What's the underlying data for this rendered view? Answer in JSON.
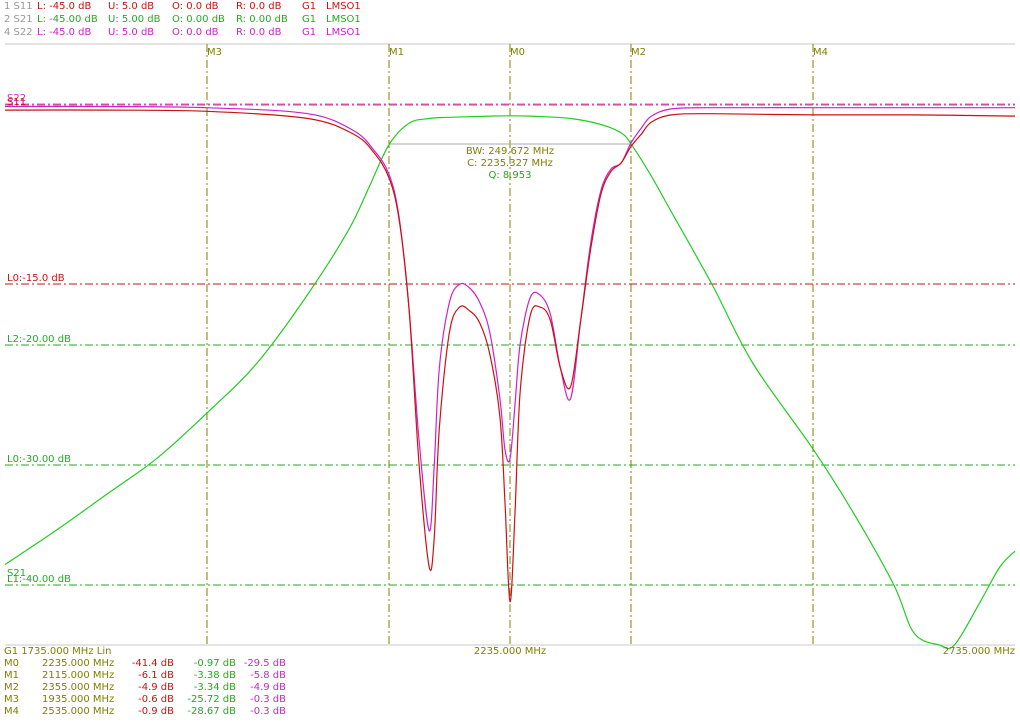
{
  "colors": {
    "s11": "#cc1111",
    "s21": "#22cc22",
    "s22": "#cc22cc",
    "grid": "#808000",
    "hdr_index": "#999999"
  },
  "header": [
    {
      "index": "1 S11",
      "L": "L: -45.0 dB",
      "U": "U:  5.0 dB",
      "O": "O:  0.0 dB",
      "R": "R:  0.0 dB",
      "G": "G1",
      "mode": "LMSO1",
      "color": "#cc1111"
    },
    {
      "index": "2 S21",
      "L": "L: -45.00 dB",
      "U": "U: 5.00 dB",
      "O": "O:  0.00 dB",
      "R": "R:  0.00 dB",
      "G": "G1",
      "mode": "LMSO1",
      "color": "#22aa22"
    },
    {
      "index": "4 S22",
      "L": "L: -45.0 dB",
      "U": "U:  5.0 dB",
      "O": "O:  0.0 dB",
      "R": "R:  0.0 dB",
      "G": "G1",
      "mode": "LMSO1",
      "color": "#cc22cc"
    }
  ],
  "markers_top": [
    "M3",
    "M1",
    "M0",
    "M2",
    "M4"
  ],
  "trace_labels": {
    "s22": "S22",
    "s11": "S11",
    "s21": "S21"
  },
  "limit_lines": [
    {
      "label": "L0:-15.0 dB",
      "color": "#cc1111"
    },
    {
      "label": "L2:-20.00 dB",
      "color": "#22aa22"
    },
    {
      "label": "L0:-30.00 dB",
      "color": "#22aa22"
    },
    {
      "label": "L1:-40.00 dB",
      "color": "#22aa22"
    }
  ],
  "bw_box": {
    "bw": "BW: 249.672 MHz",
    "c": "C: 2235.327 MHz",
    "q": "Q: 8.953"
  },
  "axis": {
    "left": "G1    1735.000 MHz  Lin",
    "center": "2235.000 MHz",
    "right": "2735.000 MHz"
  },
  "marker_table": [
    {
      "name": "M0",
      "freq": "2235.000 MHz",
      "s11": "-41.4 dB",
      "s21": "-0.97 dB",
      "s22": "-29.5 dB"
    },
    {
      "name": "M1",
      "freq": "2115.000 MHz",
      "s11": "-6.1 dB",
      "s21": "-3.38 dB",
      "s22": "-5.8 dB"
    },
    {
      "name": "M2",
      "freq": "2355.000 MHz",
      "s11": "-4.9 dB",
      "s21": "-3.34 dB",
      "s22": "-4.9 dB"
    },
    {
      "name": "M3",
      "freq": "1935.000 MHz",
      "s11": "-0.6 dB",
      "s21": "-25.72 dB",
      "s22": "-0.3 dB"
    },
    {
      "name": "M4",
      "freq": "2535.000 MHz",
      "s11": "-0.9 dB",
      "s21": "-28.67 dB",
      "s22": "-0.3 dB"
    }
  ],
  "chart_data": {
    "type": "line",
    "x_range_mhz": [
      1735,
      2735
    ],
    "y_range_db": [
      -45,
      5
    ],
    "markers_mhz": {
      "M3": 1935,
      "M1": 2115,
      "M0": 2235,
      "M2": 2355,
      "M4": 2535
    },
    "limit_lines_db": [
      -15,
      -20,
      -30,
      -40
    ],
    "series": [
      {
        "name": "S11",
        "color": "#cc1111",
        "x": [
          1735,
          1835,
          1935,
          2035,
          2080,
          2100,
          2115,
          2125,
          2135,
          2145,
          2155,
          2160,
          2165,
          2175,
          2185,
          2195,
          2205,
          2215,
          2225,
          2230,
          2235,
          2240,
          2245,
          2255,
          2265,
          2275,
          2285,
          2295,
          2305,
          2315,
          2325,
          2335,
          2345,
          2355,
          2365,
          2375,
          2395,
          2435,
          2535,
          2635,
          2735
        ],
        "y": [
          -0.5,
          -0.5,
          -0.6,
          -1.2,
          -2.5,
          -4.0,
          -6.1,
          -9.5,
          -17,
          -30,
          -38.5,
          -36,
          -27,
          -19,
          -16.9,
          -17.2,
          -18.2,
          -20.8,
          -26,
          -33,
          -41.4,
          -34,
          -24,
          -17.6,
          -16.9,
          -18,
          -22,
          -23.5,
          -18,
          -12,
          -7.5,
          -5.6,
          -4.9,
          -3.5,
          -2.5,
          -1.5,
          -0.9,
          -0.8,
          -0.9,
          -0.9,
          -1.0
        ]
      },
      {
        "name": "S22",
        "color": "#cc22cc",
        "x": [
          1735,
          1835,
          1935,
          2035,
          2080,
          2100,
          2115,
          2125,
          2135,
          2145,
          2155,
          2160,
          2165,
          2175,
          2185,
          2195,
          2205,
          2215,
          2225,
          2230,
          2235,
          2240,
          2245,
          2255,
          2265,
          2275,
          2285,
          2295,
          2305,
          2315,
          2325,
          2335,
          2345,
          2355,
          2365,
          2375,
          2395,
          2435,
          2535,
          2635,
          2735
        ],
        "y": [
          -0.2,
          -0.2,
          -0.3,
          -0.8,
          -2.2,
          -3.8,
          -5.8,
          -9.3,
          -17,
          -28,
          -35.5,
          -30,
          -22,
          -16.5,
          -15.0,
          -15.3,
          -16.5,
          -19.0,
          -24.5,
          -28.7,
          -29.5,
          -25,
          -20,
          -16.1,
          -15.9,
          -17.5,
          -22,
          -24.5,
          -18,
          -11.5,
          -7.2,
          -5.4,
          -4.9,
          -3.2,
          -2.0,
          -1.0,
          -0.4,
          -0.3,
          -0.3,
          -0.3,
          -0.3
        ]
      },
      {
        "name": "S21",
        "color": "#22cc22",
        "x": [
          1735,
          1785,
          1835,
          1885,
          1935,
          1985,
          2035,
          2075,
          2095,
          2115,
          2135,
          2155,
          2175,
          2215,
          2235,
          2255,
          2295,
          2325,
          2345,
          2355,
          2375,
          2395,
          2435,
          2475,
          2535,
          2575,
          2615,
          2635,
          2660,
          2675,
          2700,
          2720,
          2735
        ],
        "y": [
          -38.3,
          -35.5,
          -32.5,
          -29.5,
          -25.7,
          -21.5,
          -15.8,
          -10.5,
          -7.0,
          -3.4,
          -1.6,
          -1.2,
          -1.1,
          -1.0,
          -0.97,
          -1.0,
          -1.2,
          -1.7,
          -2.4,
          -3.34,
          -6.0,
          -9.0,
          -15.0,
          -21.5,
          -28.7,
          -34.0,
          -40.0,
          -44.0,
          -46,
          -46,
          -41.5,
          -38.5,
          -37.2
        ]
      }
    ]
  }
}
